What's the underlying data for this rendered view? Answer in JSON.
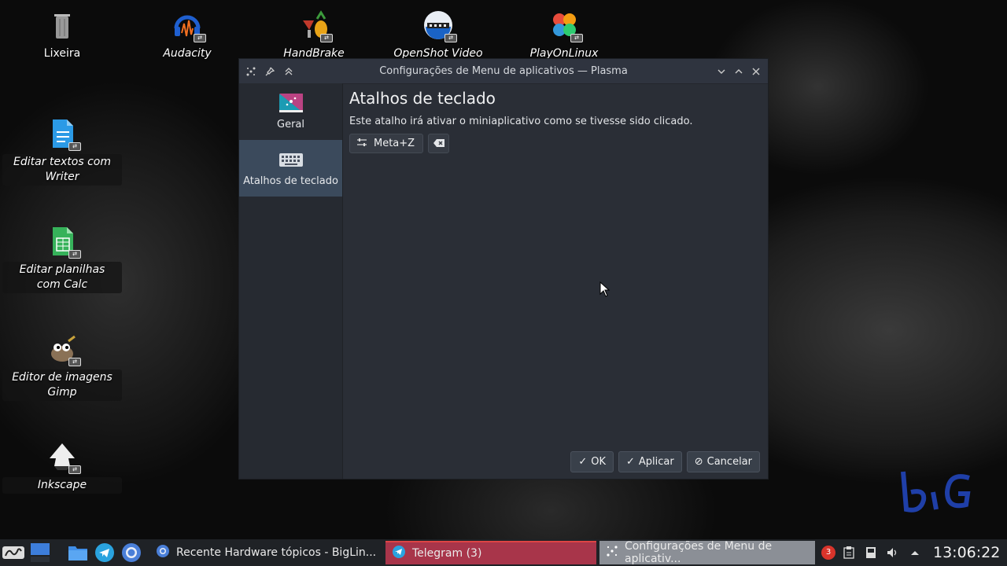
{
  "desktop": {
    "icons": [
      {
        "label": "Lixeira"
      },
      {
        "label": "Audacity"
      },
      {
        "label": "HandBrake"
      },
      {
        "label": "OpenShot Video"
      },
      {
        "label": "PlayOnLinux"
      },
      {
        "label": "Editar textos com Writer"
      },
      {
        "label": "Editar planilhas com Calc"
      },
      {
        "label": "Editor de imagens Gimp"
      },
      {
        "label": "Inkscape"
      }
    ],
    "watermark": "BiG"
  },
  "dialog": {
    "title": "Configurações de Menu de aplicativos — Plasma",
    "sidebar": [
      {
        "label": "Geral",
        "icon": "application-menu-icon"
      },
      {
        "label": "Atalhos de teclado",
        "icon": "keyboard-icon"
      }
    ],
    "heading": "Atalhos de teclado",
    "description": "Este atalho irá ativar o miniaplicativo como se tivesse sido clicado.",
    "shortcut": "Meta+Z",
    "buttons": {
      "ok": "OK",
      "apply": "Aplicar",
      "cancel": "Cancelar"
    }
  },
  "taskbar": {
    "tasks": [
      {
        "label": "Recente Hardware tópicos - BigLin..."
      },
      {
        "label": "Telegram (3)"
      },
      {
        "label": "Configurações de Menu de aplicativ..."
      }
    ],
    "notification_count": "3",
    "clock": "13:06:22"
  },
  "colors": {
    "accent": "#3b4a5c",
    "telegram_task": "#a8354a",
    "watermark": "#1f3fa8"
  }
}
